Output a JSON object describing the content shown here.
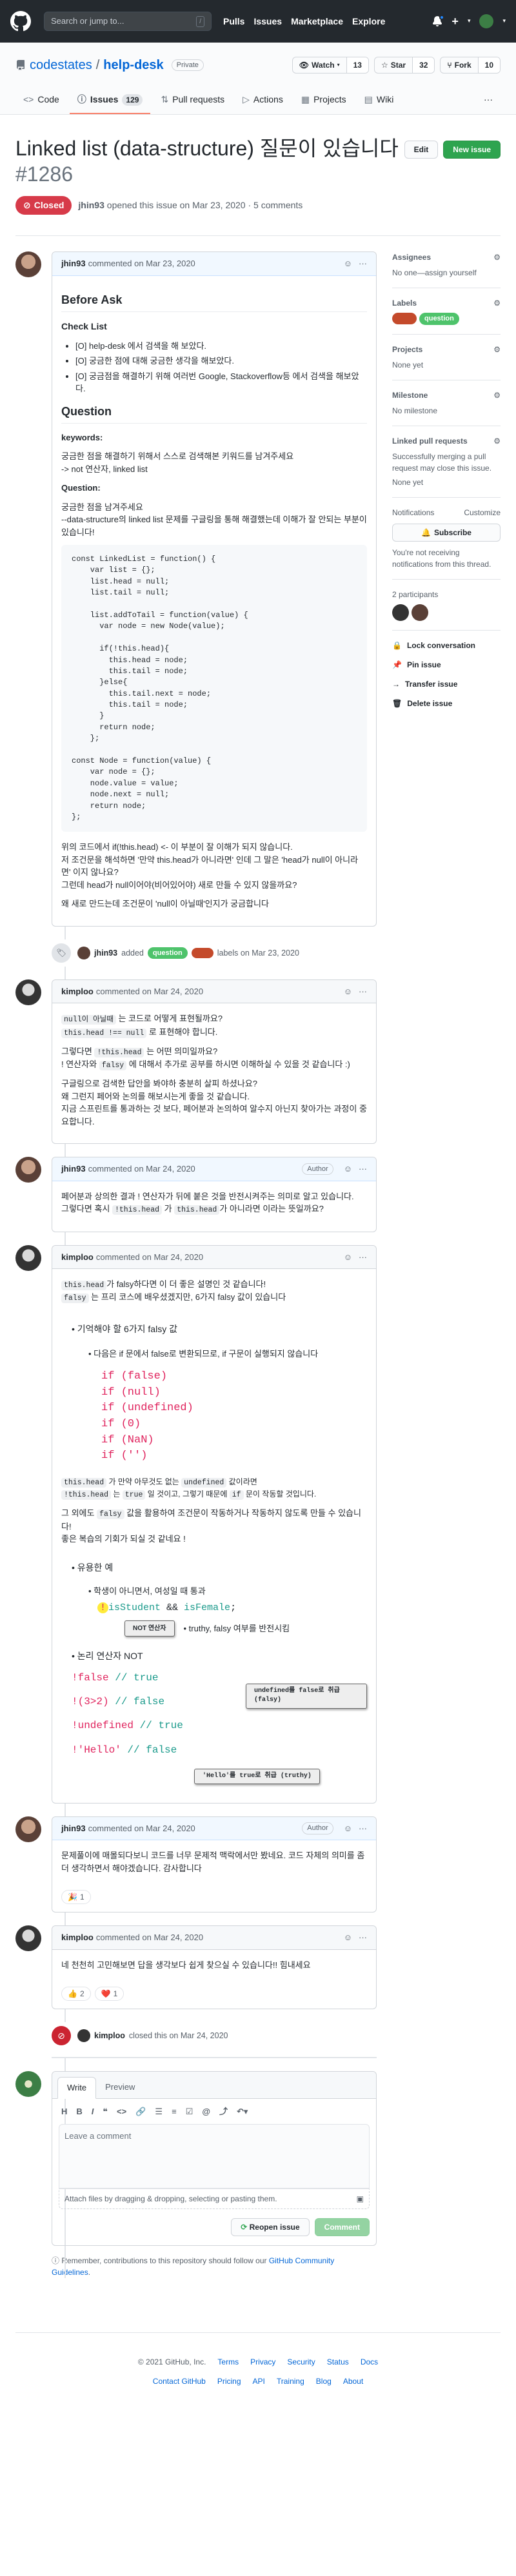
{
  "header": {
    "search_placeholder": "Search or jump to...",
    "search_shortcut": "/",
    "nav": [
      "Pulls",
      "Issues",
      "Marketplace",
      "Explore"
    ],
    "plus": "+"
  },
  "repo": {
    "owner": "codestates",
    "separator": "/",
    "name": "help-desk",
    "visibility": "Private",
    "watch_label": "Watch",
    "watch_count": "13",
    "star_label": "Star",
    "star_count": "32",
    "fork_label": "Fork",
    "fork_count": "10",
    "tabs": [
      {
        "label": "Code"
      },
      {
        "label": "Issues",
        "count": "129"
      },
      {
        "label": "Pull requests"
      },
      {
        "label": "Actions"
      },
      {
        "label": "Projects"
      },
      {
        "label": "Wiki"
      }
    ],
    "more": "···"
  },
  "issue": {
    "title": "Linked list (data-structure) 질문이 있습니다",
    "number": "#1286",
    "edit_label": "Edit",
    "new_issue_label": "New issue",
    "state": "Closed",
    "opened_by": "jhin93",
    "opened_text": "opened this issue on Mar 23, 2020 · 5 comments"
  },
  "comments": [
    {
      "author": "jhin93",
      "meta": "commented on Mar 23, 2020",
      "before_ask": "Before Ask",
      "checklist_title": "Check List",
      "checklist": [
        "[O] help-desk 에서 검색을 해 보았다.",
        "[O] 궁금한 점에 대해 궁금한 생각을 해보았다.",
        "[O] 궁금점을 해결하기 위해 여러번 Google, Stackoverflow등 에서 검색을 해보았다."
      ],
      "question_h": "Question",
      "keywords_label": "keywords:",
      "keywords_text1": "궁금한 점을 해결하기 위해서 스스로 검색해본 키워드를 남겨주세요",
      "keywords_text2": "-> not 연산자, linked list",
      "question_label": "Question:",
      "question_text1": "궁금한 점을 남겨주세요",
      "question_text2": "--data-structure의 linked list 문제를 구글링을 통해 해결했는데 이해가 잘 안되는 부분이 있습니다!",
      "code": "const LinkedList = function() {\n    var list = {};\n    list.head = null;\n    list.tail = null;\n\n    list.addToTail = function(value) {\n      var node = new Node(value);\n\n      if(!this.head){\n        this.head = node;\n        this.tail = node;\n      }else{\n        this.tail.next = node;\n        this.tail = node;\n      }\n      return node;\n    };\n\nconst Node = function(value) {\n    var node = {};\n    node.value = value;\n    node.next = null;\n    return node;\n};",
      "after1": "위의 코드에서 if(!this.head) <- 이 부분이 잘 이해가 되지 않습니다.",
      "after2": "저 조건문을 해석하면 '만약 this.head가 아니라면' 인데 그 말은 'head가 null이 아니라면' 이지 않나요?",
      "after3": "그런데 head가 null이어야(비어있어야) 새로 만들 수 있지 않을까요?",
      "after4": "왜 새로 만드는데 조건문이 'null이 아닐때'인지가 궁금합니다"
    },
    {
      "author": "kimploo",
      "meta": "commented on Mar 24, 2020",
      "p1a": "null이 아닐때",
      "p1b": " 는 코드로 어떻게 표현될까요?",
      "p1c": "this.head !== null",
      "p1d": " 로 표현해야 합니다.",
      "p2a": "그렇다면 ",
      "p2b": "!this.head",
      "p2c": " 는 어떤 의미일까요?",
      "p2d": "! 연산자와 ",
      "p2e": "falsy",
      "p2f": " 에 대해서 추가로 공부를 하시면 이해하실 수 있을 것 같습니다 :)",
      "p3a": "구글링으로 검색한 답안을 봐야하 충분히 살피 하셨나요?",
      "p3b": "왜 그런지 페어와 논의를 해보시는게 좋을 것 같습니다.",
      "p3c": "지금 스프린트를 통과하는 것 보다, 페어분과 논의하여 알수지 아닌지 찾아가는 과정이 중요합니다."
    },
    {
      "author": "jhin93",
      "meta": "commented on Mar 24, 2020",
      "author_tag": "Author",
      "p1": "페어분과 상의한 결과 ! 연산자가 뒤에 붙은 것을 반전시켜주는 의미로 알고 있습니다.",
      "p2a": "그렇다면 혹시 ",
      "p2b": "!this.head",
      "p2c": " 가 ",
      "p2d": "this.head",
      "p2e": "가 아니라면 이라는 뜻일까요?"
    },
    {
      "author": "kimploo",
      "meta": "commented on Mar 24, 2020",
      "p1a": "this.head",
      "p1b": "가 falsy하다면 이 더 좋은 설명인 것 같습니다!",
      "p1c": "falsy",
      "p1d": " 는 프리 코스에 배우셨겠지만, 6가지 falsy 값이 있습니다",
      "remember": "기억해야 할 6가지 falsy 값",
      "if_intro": "다음은 if 문에서 false로 변환되므로, if 구문이 실행되지 않습니다",
      "falsy_lines": [
        "if (false)",
        "if (null)",
        "if (undefined)",
        "if (0)",
        "if (NaN)",
        "if ('')"
      ],
      "p2a": "this.head",
      "p2b": " 가 만약 아무것도 없는 ",
      "p2c": "undefined",
      "p2d": " 값이라면",
      "p2e": "!this.head",
      "p2f": " 는 ",
      "p2g": "true",
      "p2h": " 일 것이고, 그렇기 때문에 ",
      "p2i": "if",
      "p2j": " 문이 작동할 것입니다.",
      "p3a": "그 외에도 ",
      "p3b": "falsy",
      "p3c": " 값을 활용하여 조건문이 작동하거나 작동하지 않도록 만들 수 있습니다!",
      "p3d": "좋은 복습의 기회가 되실 것 같네요 !",
      "useful": "유용한 예",
      "student": "학생이 아니면서, 여성일 때 통과",
      "expr_bang": "!",
      "expr_a": "isStudent",
      "expr_and": " && ",
      "expr_b": "isFemale",
      "expr_end": ";",
      "callout_not": "NOT 연산자",
      "truthy_note": "truthy, falsy 여부를 반전시킴",
      "logic_not": "논리 연산자 NOT",
      "not_lines": [
        {
          "expr": "!false",
          "result": "true"
        },
        {
          "expr": "!(3>2)",
          "result": "false"
        },
        {
          "expr": "!undefined",
          "result": "true"
        },
        {
          "expr": "!'Hello'",
          "result": "false"
        }
      ],
      "callout_undef": "undefined를 false로 취급 (falsy)",
      "callout_hello": "'Hello'를 true로 취급 (truthy)"
    },
    {
      "author": "jhin93",
      "meta": "commented on Mar 24, 2020",
      "author_tag": "Author",
      "p1": "문제풀이에 매몰되다보니 코드를 너무 문제적 맥락에서만 봤네요. 코드 자체의 의미를 좀 더 생각하면서 해야겠습니다. 감사합니다",
      "reaction_emoji": "🎉",
      "reaction_count": "1"
    },
    {
      "author": "kimploo",
      "meta": "commented on Mar 24, 2020",
      "p1": "네 천천히 고민해보면 답을 생각보다 쉽게 찾으실 수 있습니다!! 힘내세요",
      "reactions": [
        {
          "emoji": "👍",
          "count": "2"
        },
        {
          "emoji": "❤️",
          "count": "1"
        }
      ]
    }
  ],
  "events": {
    "labels_actor": "jhin93",
    "labels_verb": "added",
    "labels": [
      {
        "name": "question",
        "color": "#4ec36b"
      },
      {
        "name": "",
        "color": "#c44a2b"
      }
    ],
    "labels_tail": "labels on Mar 23, 2020",
    "closed_actor": "kimploo",
    "closed_text": "closed this on Mar 24, 2020"
  },
  "composer": {
    "tab_write": "Write",
    "tab_preview": "Preview",
    "placeholder": "Leave a comment",
    "attach": "Attach files by dragging & dropping, selecting or pasting them.",
    "reopen": "Reopen issue",
    "comment": "Comment",
    "remember_text": "Remember, contributions to this repository should follow our ",
    "remember_link": "GitHub Community Guidelines",
    "remember_end": "."
  },
  "sidebar": {
    "assignees_h": "Assignees",
    "assignees_txt": "No one—assign yourself",
    "labels_h": "Labels",
    "labels": [
      {
        "name": "",
        "color": "#c44a2b"
      },
      {
        "name": "question",
        "color": "#4ec36b"
      }
    ],
    "projects_h": "Projects",
    "projects_txt": "None yet",
    "milestone_h": "Milestone",
    "milestone_txt": "No milestone",
    "linked_h": "Linked pull requests",
    "linked_txt": "Successfully merging a pull request may close this issue.",
    "linked_none": "None yet",
    "notif_h": "Notifications",
    "notif_customize": "Customize",
    "subscribe": "Subscribe",
    "notif_txt": "You're not receiving notifications from this thread.",
    "participants_h": "2 participants",
    "lock": "Lock conversation",
    "pin": "Pin issue",
    "transfer": "Transfer issue",
    "delete": "Delete issue"
  },
  "footer": {
    "copyright": "© 2021 GitHub, Inc.",
    "row1": [
      "Terms",
      "Privacy",
      "Security",
      "Status",
      "Docs"
    ],
    "row2": [
      "Contact GitHub",
      "Pricing",
      "API",
      "Training",
      "Blog",
      "About"
    ]
  },
  "colors": {
    "header_bg": "#24292e",
    "closed": "#d73a49",
    "green": "#2ea44f",
    "link": "#0366d6"
  }
}
